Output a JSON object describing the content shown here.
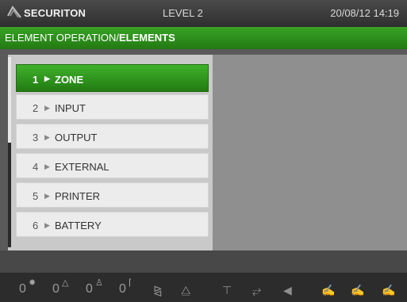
{
  "topbar": {
    "brand": "SECURITON",
    "level": "LEVEL 2",
    "datetime": "20/08/12 14:19"
  },
  "titlebar": {
    "prefix": "ELEMENT OPERATION/",
    "suffix": "ELEMENTS"
  },
  "menu": {
    "items": [
      {
        "number": "1",
        "label": "ZONE",
        "active": true
      },
      {
        "number": "2",
        "label": "INPUT",
        "active": false
      },
      {
        "number": "3",
        "label": "OUTPUT",
        "active": false
      },
      {
        "number": "4",
        "label": "EXTERNAL",
        "active": false
      },
      {
        "number": "5",
        "label": "PRINTER",
        "active": false
      },
      {
        "number": "6",
        "label": "BATTERY",
        "active": false
      }
    ]
  },
  "status": {
    "counters": [
      {
        "value": "0",
        "icon": "sun-icon"
      },
      {
        "value": "0",
        "icon": "triangle-icon"
      },
      {
        "value": "0",
        "icon": "person-icon"
      },
      {
        "value": "0",
        "icon": "wrench-icon"
      }
    ],
    "icons": [
      "bell-off-icon",
      "horn-off-icon",
      "siren-icon",
      "bird-icon",
      "speaker-icon",
      "hand-icon",
      "hand-alt-icon",
      "hand-check-icon"
    ]
  },
  "colors": {
    "accent_green": "#2e8f1c",
    "header_dark": "#3a3a3a",
    "panel_gray": "#8f8f8f"
  }
}
